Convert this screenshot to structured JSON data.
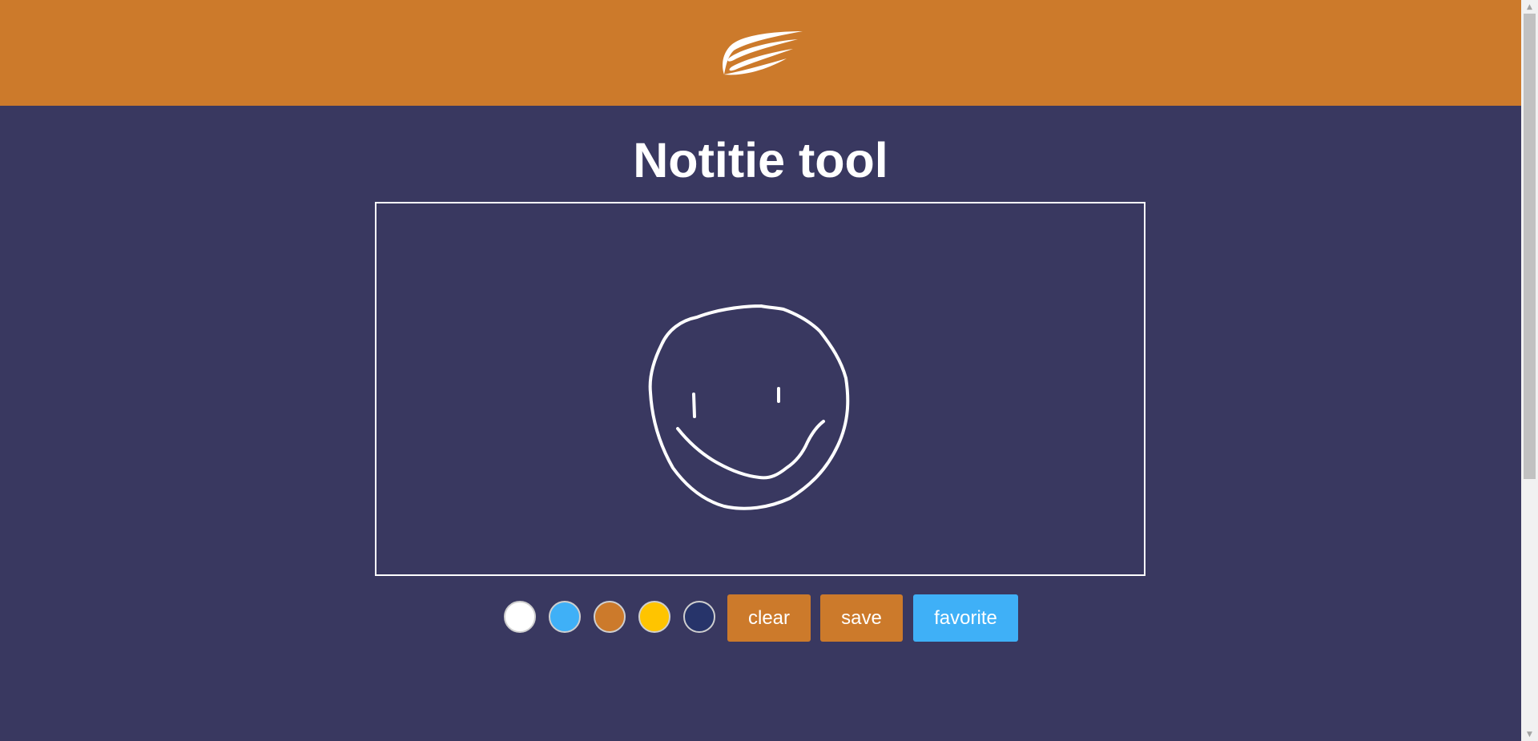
{
  "app": {
    "title": "Notitie tool",
    "logo_icon": "wing-logo-icon"
  },
  "colors": {
    "header_bg": "#cc7a2b",
    "page_bg": "#393860",
    "accent_orange": "#cc7a2b",
    "accent_blue": "#3fb0f7"
  },
  "canvas": {
    "drawing": "smiley-face",
    "stroke_color": "#ffffff"
  },
  "toolbar": {
    "swatches": [
      {
        "name": "white",
        "color": "#ffffff"
      },
      {
        "name": "blue",
        "color": "#3fb0f7"
      },
      {
        "name": "orange",
        "color": "#cc7a2b"
      },
      {
        "name": "yellow",
        "color": "#ffc400"
      },
      {
        "name": "navy",
        "color": "#27346a"
      }
    ],
    "clear_label": "clear",
    "save_label": "save",
    "favorite_label": "favorite"
  },
  "scrollbar": {
    "up_icon": "scroll-up-arrow-icon",
    "down_icon": "scroll-down-arrow-icon"
  }
}
